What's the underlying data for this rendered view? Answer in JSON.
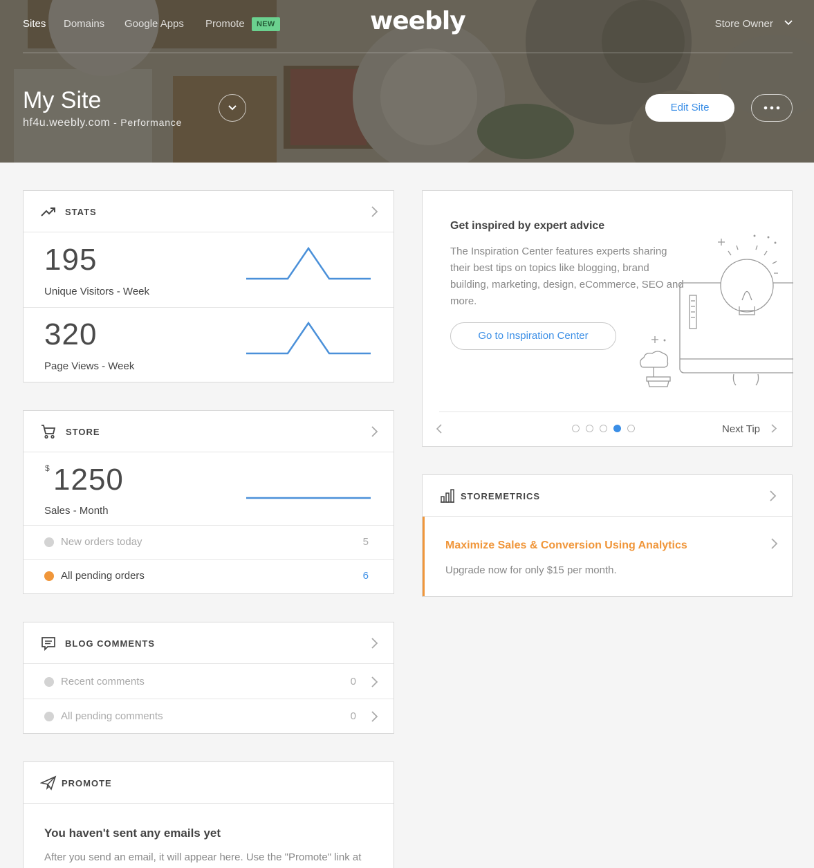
{
  "nav": {
    "items": [
      "Sites",
      "Domains",
      "Google Apps",
      "Promote"
    ],
    "badge_new": "NEW",
    "logo": "weebly",
    "account": "Store Owner"
  },
  "site": {
    "title": "My Site",
    "domain": "hf4u.weebly.com",
    "separator": " - ",
    "plan": "Performance",
    "edit_button": "Edit Site"
  },
  "stats": {
    "title": "STATS",
    "metrics": [
      {
        "value": "195",
        "label": "Unique Visitors - Week"
      },
      {
        "value": "320",
        "label": "Page Views - Week"
      }
    ]
  },
  "store": {
    "title": "STORE",
    "currency": "$",
    "sales_value": "1250",
    "sales_label": "Sales - Month",
    "rows": [
      {
        "label": "New orders today",
        "count": "5",
        "status_color": "#d3d3d3"
      },
      {
        "label": "All pending orders",
        "count": "6",
        "status_color": "#f0963a"
      }
    ]
  },
  "blog": {
    "title": "BLOG COMMENTS",
    "rows": [
      {
        "label": "Recent comments",
        "count": "0"
      },
      {
        "label": "All pending comments",
        "count": "0"
      }
    ]
  },
  "promote": {
    "title": "PROMOTE",
    "heading": "You haven't sent any emails yet",
    "text": "After you send an email, it will appear here. Use the \"Promote\" link at the top of the page to go to Weebly Promote."
  },
  "inspiration": {
    "title": "Get inspired by expert advice",
    "description": "The Inspiration Center features experts sharing their best tips on topics like blogging, brand building, marketing, design, eCommerce, SEO and more.",
    "button": "Go to Inspiration Center",
    "pager_count": 5,
    "pager_active": 4,
    "next_label": "Next Tip"
  },
  "storemetrics": {
    "title": "STOREMETRICS",
    "promo_title": "Maximize Sales & Conversion Using Analytics",
    "promo_sub": "Upgrade now for only $15 per month."
  },
  "colors": {
    "accent_blue": "#3a8ee6",
    "accent_orange": "#f0963a",
    "badge_green": "#6bd18f"
  }
}
